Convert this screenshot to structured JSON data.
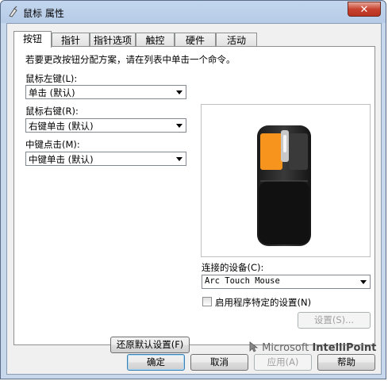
{
  "window": {
    "title": "鼠标 属性",
    "close_label": "✕"
  },
  "tabs": [
    {
      "label": "按钮",
      "active": true
    },
    {
      "label": "指针",
      "active": false
    },
    {
      "label": "指针选项",
      "active": false
    },
    {
      "label": "触控",
      "active": false
    },
    {
      "label": "硬件",
      "active": false
    },
    {
      "label": "活动",
      "active": false
    }
  ],
  "panel": {
    "instruction": "若要更改按钮分配方案，请在列表中单击一个命令。",
    "left_button": {
      "label": "鼠标左键(L):",
      "value": "单击 (默认)"
    },
    "right_button": {
      "label": "鼠标右键(R):",
      "value": "右键单击 (默认)"
    },
    "middle_button": {
      "label": "中键点击(M):",
      "value": "中键单击 (默认)"
    },
    "device": {
      "label": "连接的设备(C):",
      "value": "Arc Touch Mouse"
    },
    "program_specific": {
      "label": "启用程序特定的设置(N)",
      "checked": false
    },
    "settings_button": "设置(S)...",
    "restore_button": "还原默认设置(F)",
    "logo_text_1": "Microsoft",
    "logo_text_2": "IntelliPoint",
    "accent_color": "#f7941d"
  },
  "footer": {
    "ok": "确定",
    "cancel": "取消",
    "apply": "应用(A)",
    "help": "帮助"
  }
}
